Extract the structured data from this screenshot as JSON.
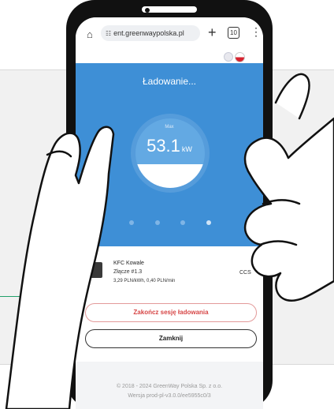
{
  "browser": {
    "url": "ent.greenwaypolska.pl",
    "tabs_count": "10"
  },
  "charging": {
    "title": "Ładowanie...",
    "gauge_label": "Max",
    "power_value": "53.1",
    "power_unit": "kW",
    "gauge_level": 0.34,
    "carousel_pages": 4,
    "carousel_active": 3
  },
  "station": {
    "name": "KFC Kowale",
    "connector": "Złącze #1.3",
    "price": "3,29 PLN/kWh, 0,40 PLN/min",
    "type_label": "CCS"
  },
  "actions": {
    "end_session": "Zakończ sesję ładowania",
    "close": "Zamknij"
  },
  "footer": {
    "copyright": "© 2018 - 2024 GreenWay Polska Sp. z o.o.",
    "version": "Wersja prod-pl-v3.0.0/ee5955c0/3"
  },
  "colors": {
    "accent_blue": "#3e8fd6",
    "end_button_red": "#d64545",
    "pointer_green": "#22a06b"
  }
}
